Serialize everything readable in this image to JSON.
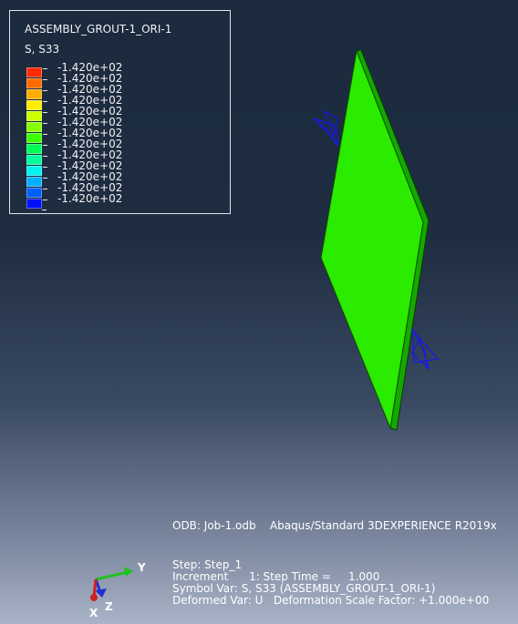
{
  "legend": {
    "instance_title": "ASSEMBLY_GROUT-1_ORI-1",
    "variable": "S, S33",
    "colors": [
      "#ff2a00",
      "#ff6a00",
      "#ffae00",
      "#ffee00",
      "#ccff00",
      "#88ff00",
      "#3dff00",
      "#00ff55",
      "#00ffa0",
      "#00f5f0",
      "#00b0ff",
      "#0060ff",
      "#0010ff"
    ],
    "values": [
      "-1.420e+02",
      "-1.420e+02",
      "-1.420e+02",
      "-1.420e+02",
      "-1.420e+02",
      "-1.420e+02",
      "-1.420e+02",
      "-1.420e+02",
      "-1.420e+02",
      "-1.420e+02",
      "-1.420e+02",
      "-1.420e+02",
      "-1.420e+02"
    ]
  },
  "model": {
    "fill_color": "#22ee00",
    "bc_color": "#1010e0"
  },
  "info": {
    "odb_line": "ODB: Job-1.odb    Abaqus/Standard 3DEXPERIENCE R2019x",
    "step_line": "Step: Step_1",
    "increment_line": "Increment      1: Step Time =     1.000",
    "symbol_line": "Symbol Var: S, S33 (ASSEMBLY_GROUT-1_ORI-1)",
    "deformed_line": "Deformed Var: U   Deformation Scale Factor: +1.000e+00"
  },
  "triad": {
    "x_label": "X",
    "y_label": "Y",
    "z_label": "Z"
  }
}
